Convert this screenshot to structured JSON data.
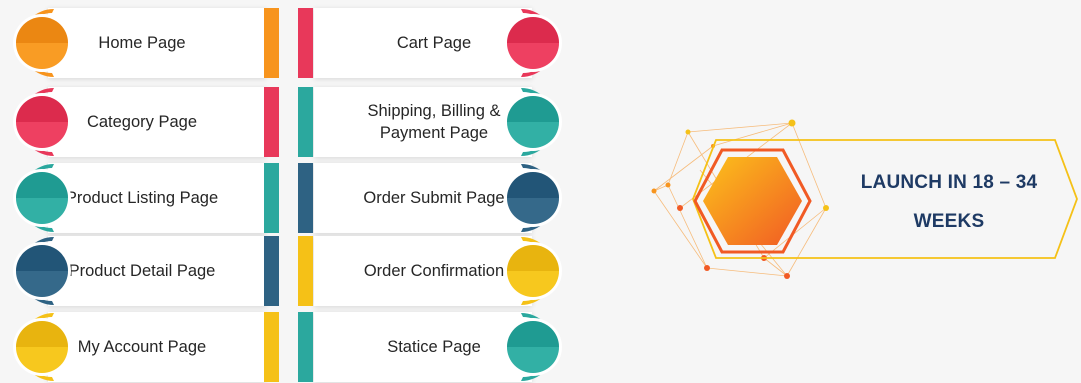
{
  "left_column": [
    {
      "label": "Home Page",
      "color": "#f7941d"
    },
    {
      "label": "Category Page",
      "color": "#e8385a"
    },
    {
      "label": "Product Listing Page",
      "color": "#2ba89e"
    },
    {
      "label": "Product Detail Page",
      "color": "#2e6283"
    },
    {
      "label": "My Account Page",
      "color": "#f5c117"
    }
  ],
  "right_column": [
    {
      "label": "Cart Page",
      "color": "#e8385a"
    },
    {
      "label": "Shipping, Billing & Payment Page",
      "color": "#2ba89e"
    },
    {
      "label": "Order Submit Page",
      "color": "#2e6283"
    },
    {
      "label": "Order Confirmation",
      "color": "#f5c117"
    },
    {
      "label": "Statice Page",
      "color": "#2ba89e"
    }
  ],
  "launch": {
    "line1": "LAUNCH IN 18 – 34",
    "line2": "WEEKS",
    "text_color": "#1e3a64",
    "hexagon_colors": [
      "#fcc21b",
      "#f15a24"
    ],
    "frame_color": "#f5c117"
  }
}
